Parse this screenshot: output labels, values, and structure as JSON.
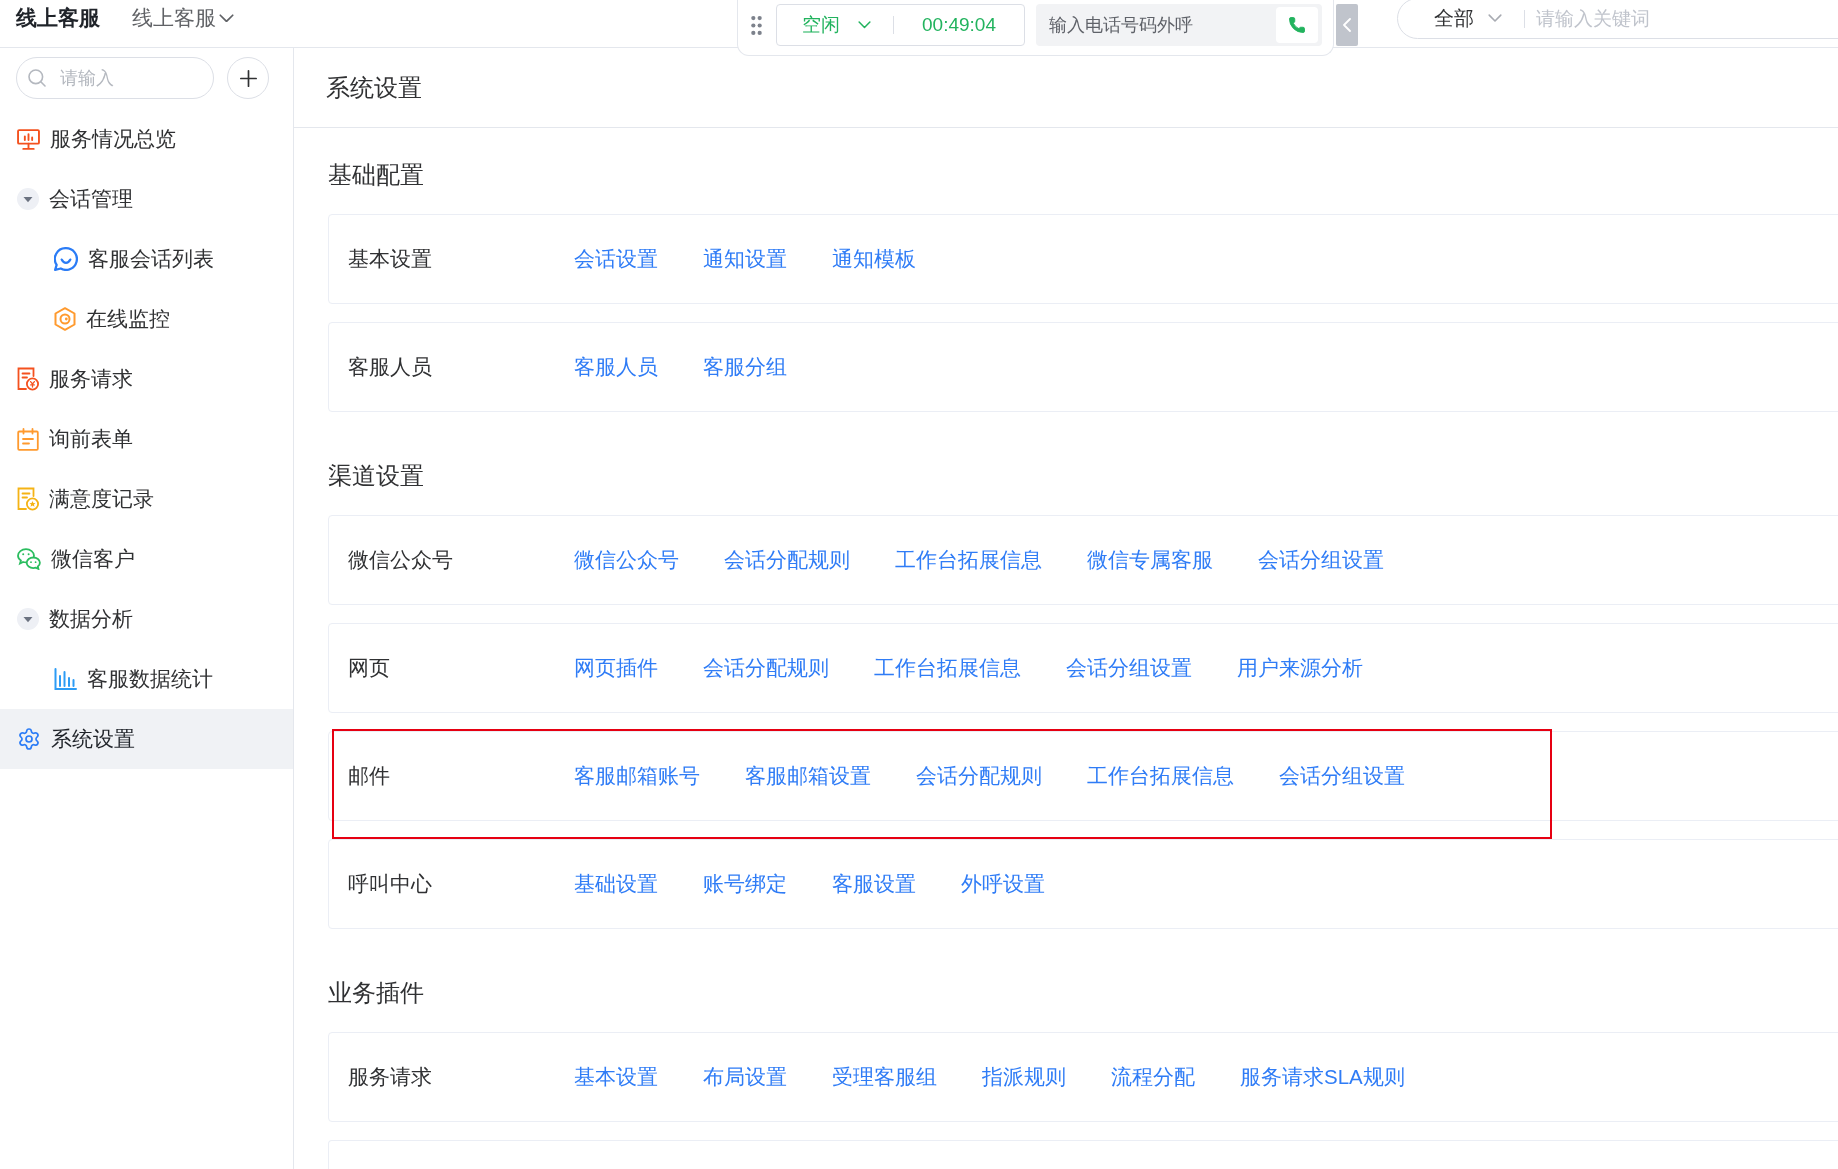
{
  "header": {
    "title": "线上客服",
    "switcher": "线上客服"
  },
  "call_bar": {
    "status": "空闲",
    "timer": "00:49:04",
    "dial_field": {
      "placeholder": "输入电话号码外呼"
    }
  },
  "global_search": {
    "scope": "全部",
    "placeholder": "请输入关键词"
  },
  "sidebar": {
    "search": {
      "placeholder": "请输入"
    },
    "items": [
      {
        "kind": "page",
        "label": "服务情况总览",
        "selected": false
      },
      {
        "kind": "group",
        "label": "会话管理",
        "expanded": true,
        "selected": false,
        "children": [
          {
            "kind": "page",
            "label": "客服会话列表",
            "selected": false
          },
          {
            "kind": "page",
            "label": "在线监控",
            "selected": false
          }
        ]
      },
      {
        "kind": "page",
        "label": "服务请求",
        "selected": false
      },
      {
        "kind": "page",
        "label": "询前表单",
        "selected": false
      },
      {
        "kind": "page",
        "label": "满意度记录",
        "selected": false
      },
      {
        "kind": "page",
        "label": "微信客户",
        "selected": false
      },
      {
        "kind": "group",
        "label": "数据分析",
        "expanded": true,
        "selected": false,
        "children": [
          {
            "kind": "page",
            "label": "客服数据统计",
            "selected": false
          }
        ]
      },
      {
        "kind": "page",
        "label": "系统设置",
        "selected": true
      }
    ]
  },
  "page": {
    "title": "系统设置",
    "sections": [
      {
        "title": "基础配置",
        "rows": [
          {
            "label": "基本设置",
            "highlighted": false,
            "links": [
              "会话设置",
              "通知设置",
              "通知模板"
            ]
          },
          {
            "label": "客服人员",
            "highlighted": false,
            "links": [
              "客服人员",
              "客服分组"
            ]
          }
        ]
      },
      {
        "title": "渠道设置",
        "rows": [
          {
            "label": "微信公众号",
            "highlighted": false,
            "links": [
              "微信公众号",
              "会话分配规则",
              "工作台拓展信息",
              "微信专属客服",
              "会话分组设置"
            ]
          },
          {
            "label": "网页",
            "highlighted": false,
            "links": [
              "网页插件",
              "会话分配规则",
              "工作台拓展信息",
              "会话分组设置",
              "用户来源分析"
            ]
          },
          {
            "label": "邮件",
            "highlighted": true,
            "links": [
              "客服邮箱账号",
              "客服邮箱设置",
              "会话分配规则",
              "工作台拓展信息",
              "会话分组设置"
            ]
          },
          {
            "label": "呼叫中心",
            "highlighted": false,
            "links": [
              "基础设置",
              "账号绑定",
              "客服设置",
              "外呼设置"
            ]
          }
        ]
      },
      {
        "title": "业务插件",
        "rows": [
          {
            "label": "服务请求",
            "highlighted": false,
            "links": [
              "基本设置",
              "布局设置",
              "受理客服组",
              "指派规则",
              "流程分配",
              "服务请求SLA规则"
            ]
          }
        ]
      }
    ]
  }
}
